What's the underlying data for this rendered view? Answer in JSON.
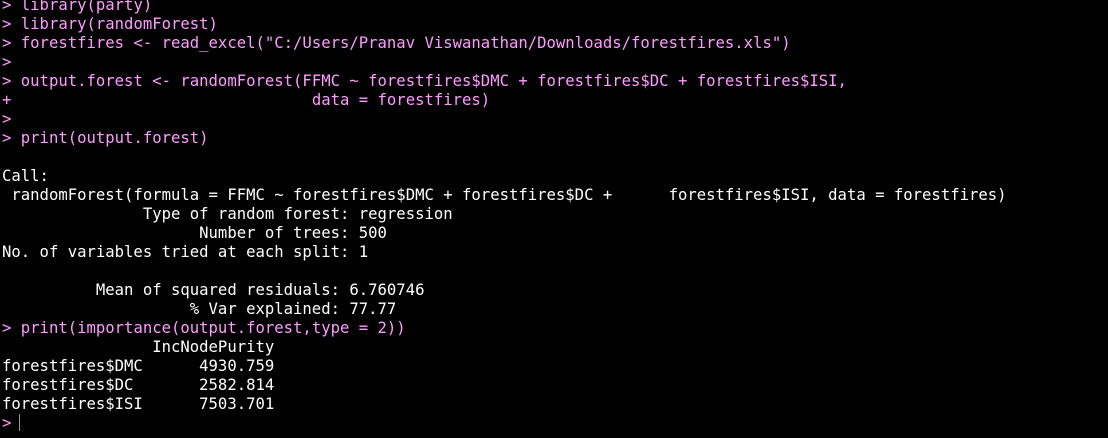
{
  "colors": {
    "background": "#000000",
    "input_text": "#ff9bff",
    "output_text": "#ffffff",
    "cursor": "#9a9a9a"
  },
  "prompt_symbol": ">",
  "continuation_symbol": "+",
  "lines": [
    {
      "kind": "input",
      "prefix": ">",
      "text": " library(party)"
    },
    {
      "kind": "input",
      "prefix": ">",
      "text": " library(randomForest)"
    },
    {
      "kind": "input",
      "prefix": ">",
      "text": " forestfires <- read_excel(\"C:/Users/Pranav Viswanathan/Downloads/forestfires.xls\")"
    },
    {
      "kind": "input",
      "prefix": ">",
      "text": ""
    },
    {
      "kind": "input",
      "prefix": ">",
      "text": " output.forest <- randomForest(FFMC ~ forestfires$DMC + forestfires$DC + forestfires$ISI,"
    },
    {
      "kind": "input",
      "prefix": "+",
      "text": "                                data = forestfires)"
    },
    {
      "kind": "input",
      "prefix": ">",
      "text": ""
    },
    {
      "kind": "input",
      "prefix": ">",
      "text": " print(output.forest)"
    },
    {
      "kind": "output",
      "prefix": "",
      "text": ""
    },
    {
      "kind": "output",
      "prefix": "",
      "text": "Call:"
    },
    {
      "kind": "output",
      "prefix": "",
      "text": " randomForest(formula = FFMC ~ forestfires$DMC + forestfires$DC +      forestfires$ISI, data = forestfires)"
    },
    {
      "kind": "output",
      "prefix": "",
      "text": "               Type of random forest: regression"
    },
    {
      "kind": "output",
      "prefix": "",
      "text": "                     Number of trees: 500"
    },
    {
      "kind": "output",
      "prefix": "",
      "text": "No. of variables tried at each split: 1"
    },
    {
      "kind": "output",
      "prefix": "",
      "text": ""
    },
    {
      "kind": "output",
      "prefix": "",
      "text": "          Mean of squared residuals: 6.760746"
    },
    {
      "kind": "output",
      "prefix": "",
      "text": "                    % Var explained: 77.77"
    },
    {
      "kind": "input",
      "prefix": ">",
      "text": " print(importance(output.forest,type = 2))"
    },
    {
      "kind": "output",
      "prefix": "",
      "text": "                IncNodePurity"
    },
    {
      "kind": "output",
      "prefix": "",
      "text": "forestfires$DMC      4930.759"
    },
    {
      "kind": "output",
      "prefix": "",
      "text": "forestfires$DC       2582.814"
    },
    {
      "kind": "output",
      "prefix": "",
      "text": "forestfires$ISI      7503.701"
    },
    {
      "kind": "active",
      "prefix": ">",
      "text": ""
    }
  ]
}
